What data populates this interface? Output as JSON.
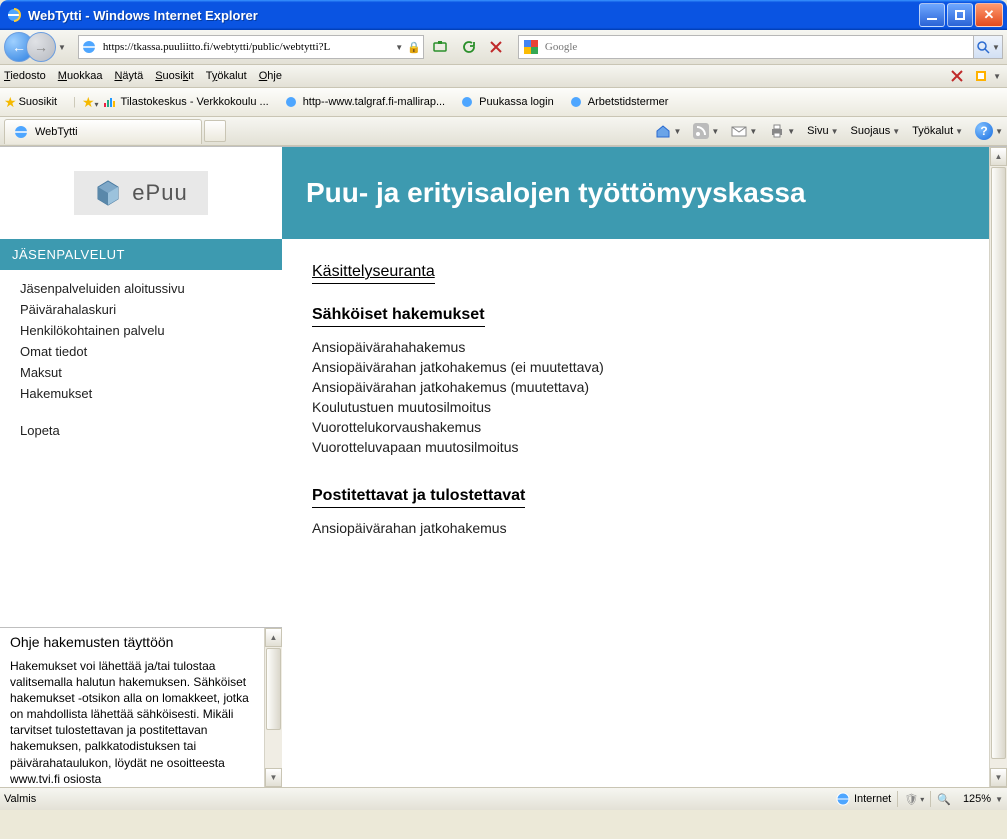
{
  "window": {
    "title": "WebTytti - Windows Internet Explorer"
  },
  "address": {
    "url": "https://tkassa.puuliitto.fi/webtytti/public/webtytti?L"
  },
  "search": {
    "provider": "Google",
    "placeholder": "Google"
  },
  "menubar": {
    "file": "Tiedosto",
    "edit": "Muokkaa",
    "view": "Näytä",
    "favorites": "Suosikit",
    "tools": "Työkalut",
    "help": "Ohje"
  },
  "favbar": {
    "label": "Suosikit",
    "items": [
      "Tilastokeskus - Verkkokoulu ...",
      "http--www.talgraf.fi-mallirap...",
      "Puukassa login",
      "Arbetstidstermer"
    ]
  },
  "tabs": {
    "active": "WebTytti"
  },
  "commandbar": {
    "page": "Sivu",
    "safety": "Suojaus",
    "tools": "Työkalut"
  },
  "content": {
    "logo_text": "ePuu",
    "header_title": "Puu- ja erityisalojen työttömyyskassa",
    "nav_header": "JÄSENPALVELUT",
    "nav_items": [
      "Jäsenpalveluiden aloitussivu",
      "Päivärahalaskuri",
      "Henkilökohtainen palvelu",
      "Omat tiedot",
      "Maksut",
      "Hakemukset"
    ],
    "nav_logout": "Lopeta",
    "help_title": "Ohje hakemusten täyttöön",
    "help_text": "Hakemukset voi lähettää ja/tai tulostaa valitsemalla halutun hakemuksen. Sähköiset hakemukset -otsikon alla on lomakkeet, jotka on mahdollista lähettää sähköisesti. Mikäli tarvitset tulostettavan ja postitettavan hakemuksen, palkkatodistuksen tai päivärahataulukon, löydät ne osoitteesta www.tvi.fi osiosta",
    "main_title": "Käsittelyseuranta",
    "section1_title": "Sähköiset hakemukset",
    "section1_links": [
      "Ansiopäivärahahakemus",
      "Ansiopäivärahan jatkohakemus (ei muutettava)",
      "Ansiopäivärahan jatkohakemus (muutettava)",
      "Koulutustuen muutosilmoitus",
      "Vuorottelukorvaushakemus",
      "Vuorotteluvapaan muutosilmoitus"
    ],
    "section2_title": "Postitettavat ja tulostettavat",
    "section2_links": [
      "Ansiopäivärahan jatkohakemus"
    ]
  },
  "statusbar": {
    "status": "Valmis",
    "zone": "Internet",
    "zoom": "125%"
  }
}
